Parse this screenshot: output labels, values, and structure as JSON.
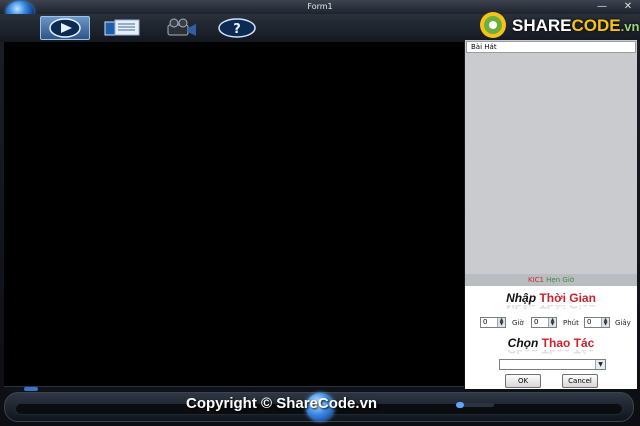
{
  "window": {
    "title": "Form1",
    "minimize_glyph": "—",
    "close_glyph": "✕"
  },
  "logo": {
    "part1": "SHARE",
    "part2": "CODE",
    "part3": ".vn"
  },
  "toolbar": {
    "buttons": [
      {
        "icon": "play-media-icon",
        "active": true
      },
      {
        "icon": "playlist-icon",
        "active": false
      },
      {
        "icon": "video-camera-icon",
        "active": false
      },
      {
        "icon": "help-icon",
        "active": false
      }
    ]
  },
  "playlist": {
    "header": "Bài Hát"
  },
  "alarm_tabs": {
    "left": "KIC1",
    "right": "Hẹn Giờ"
  },
  "time_form": {
    "heading_prefix": "Nhập",
    "heading_main": "Thời Gian",
    "hours_value": "0",
    "hours_label": "Giờ",
    "minutes_value": "0",
    "minutes_label": "Phút",
    "seconds_value": "0",
    "seconds_label": "Giây",
    "action_heading_prefix": "Chọn",
    "action_heading_main": "Thao Tác",
    "action_select_value": "",
    "ok_label": "OK",
    "cancel_label": "Cancel"
  },
  "watermark": "Copyright © ShareCode.vn",
  "colors": {
    "accent_blue": "#3a8ee6",
    "heading_red": "#c8232c",
    "panel_gray": "#868a90"
  }
}
